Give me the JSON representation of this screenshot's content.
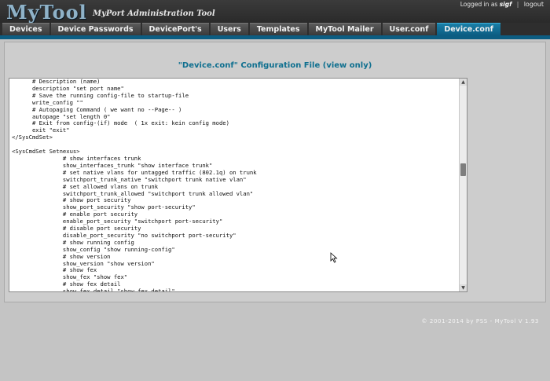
{
  "app": {
    "logo": "MyTool",
    "tagline": "MyPort Administration Tool"
  },
  "user": {
    "logged_in_label": "Logged in as",
    "username": "sigf",
    "logout_label": "logout"
  },
  "nav": {
    "tabs": [
      {
        "label": "Devices"
      },
      {
        "label": "Device Passwords"
      },
      {
        "label": "DevicePort's"
      },
      {
        "label": "Users"
      },
      {
        "label": "Templates"
      },
      {
        "label": "MyTool Mailer"
      },
      {
        "label": "User.conf"
      },
      {
        "label": "Device.conf",
        "active": true
      }
    ]
  },
  "main": {
    "title": "\"Device.conf\" Configuration File (view only)",
    "config_text": "      # Description (name)\n      description \"set port name\"\n      # Save the running config-file to startup-file\n      write_config \"\"\n      # Autopaging Command ( we want no --Page-- )\n      autopage \"set length 0\"\n      # Exit from config-(if) mode  ( 1x exit: kein config mode)\n      exit \"exit\"\n</SysCmdSet>\n\n<SysCmdSet Setnexus>\n               # show interfaces trunk\n               show_interfaces_trunk \"show interface trunk\"\n               # set native vlans for untagged traffic (802.1q) on trunk\n               switchport_trunk_native \"switchport trunk native vlan\"\n               # set allowed vlans on trunk\n               switchport_trunk_allowed \"switchport trunk allowed vlan\"\n               # show port security\n               show_port_security \"show port-security\"\n               # enable port security\n               enable_port_security \"switchport port-security\"\n               # disable port security\n               disable_port_security \"no switchport port-security\"\n               # show running config\n               show_config \"show running-config\"\n               # show version\n               show_version \"show version\"\n               # show fex\n               show_fex \"show fex\"\n               # show fex detail\n               show_fex_detail \"show fex detail\""
  },
  "footer": {
    "copyright": "© 2001-2014 by PSS - MyTool V 1.93"
  },
  "colors": {
    "accent": "#0c5d82",
    "title": "#0e6f8f",
    "header_bg": "#2e2e2e",
    "page_bg": "#c4c4c4"
  }
}
